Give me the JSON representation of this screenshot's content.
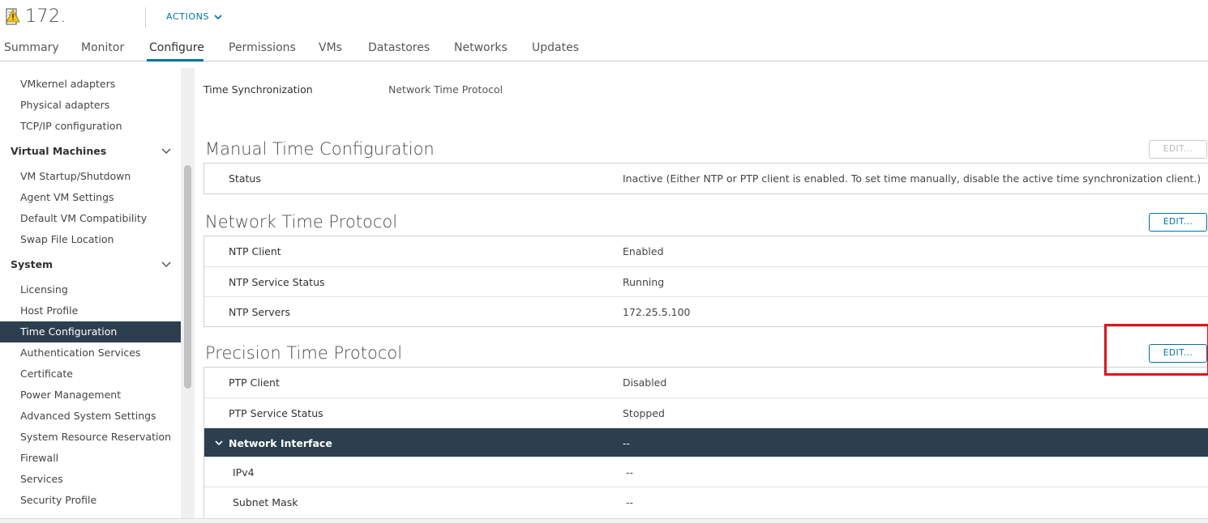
{
  "header": {
    "host_name": "172.",
    "actions_label": "ACTIONS"
  },
  "tabs": [
    {
      "label": "Summary"
    },
    {
      "label": "Monitor"
    },
    {
      "label": "Configure"
    },
    {
      "label": "Permissions"
    },
    {
      "label": "VMs"
    },
    {
      "label": "Datastores"
    },
    {
      "label": "Networks"
    },
    {
      "label": "Updates"
    }
  ],
  "active_tab": "Configure",
  "sidebar": {
    "networking_items": [
      "VMkernel adapters",
      "Physical adapters",
      "TCP/IP configuration"
    ],
    "vm_group": "Virtual Machines",
    "vm_items": [
      "VM Startup/Shutdown",
      "Agent VM Settings",
      "Default VM Compatibility",
      "Swap File Location"
    ],
    "system_group": "System",
    "system_items": [
      "Licensing",
      "Host Profile",
      "Time Configuration",
      "Authentication Services",
      "Certificate",
      "Power Management",
      "Advanced System Settings",
      "System Resource Reservation",
      "Firewall",
      "Services",
      "Security Profile"
    ],
    "selected_item": "Time Configuration"
  },
  "time_sync": {
    "label": "Time Synchronization",
    "value": "Network Time Protocol"
  },
  "manual": {
    "title": "Manual Time Configuration",
    "edit_label": "EDIT...",
    "edit_enabled": false,
    "rows": [
      {
        "label": "Status",
        "value": "Inactive (Either NTP or PTP client is enabled. To set time manually, disable the active time synchronization client.)"
      }
    ]
  },
  "ntp": {
    "title": "Network Time Protocol",
    "edit_label": "EDIT...",
    "rows": [
      {
        "label": "NTP Client",
        "value": "Enabled"
      },
      {
        "label": "NTP Service Status",
        "value": "Running"
      },
      {
        "label": "NTP Servers",
        "value": "172.25.5.100"
      }
    ]
  },
  "ptp": {
    "title": "Precision Time Protocol",
    "edit_label": "EDIT...",
    "rows": [
      {
        "label": "PTP Client",
        "value": "Disabled"
      },
      {
        "label": "PTP Service Status",
        "value": "Stopped"
      }
    ],
    "interface": {
      "label": "Network Interface",
      "value": "--"
    },
    "interface_rows": [
      {
        "label": "IPv4",
        "value": "--"
      },
      {
        "label": "Subnet Mask",
        "value": "--"
      }
    ]
  },
  "colors": {
    "accent": "#0072a3",
    "selected_bg": "#2d3f4e",
    "highlight": "#e0141e",
    "warning": "#f5c518"
  }
}
